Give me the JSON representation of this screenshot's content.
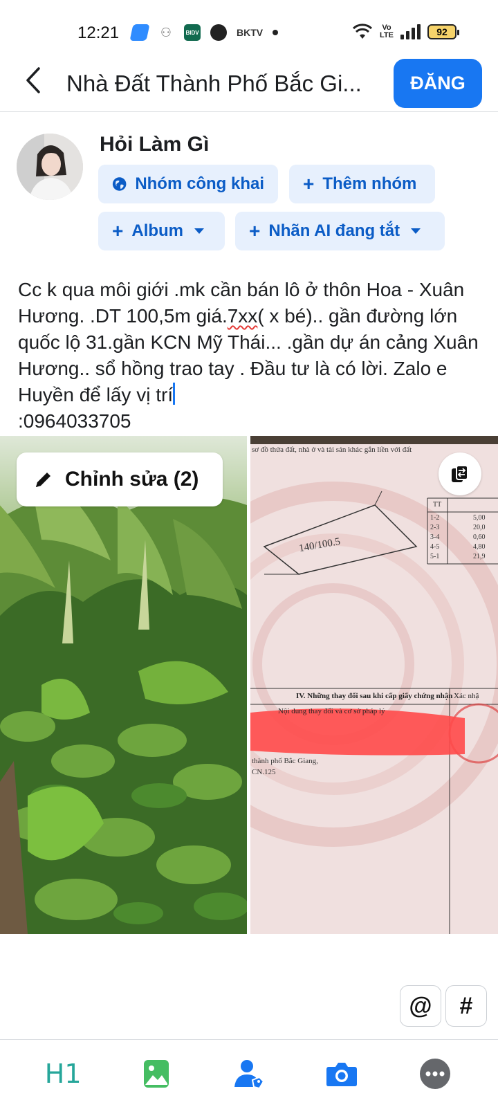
{
  "status_bar": {
    "time": "12:21",
    "bidv": "BIDV",
    "app_text": "BKTV",
    "volte": [
      "Vo",
      "LTE"
    ],
    "battery": "92"
  },
  "header": {
    "title": "Nhà Đất Thành Phố Bắc Gi...",
    "post_button": "ĐĂNG"
  },
  "composer": {
    "user_name": "Hỏi Làm Gì",
    "chips": {
      "public_group": "Nhóm công khai",
      "add_group": "Thêm nhóm",
      "album": "Album",
      "ai_label": "Nhãn AI đang tắt"
    }
  },
  "post": {
    "text_before": " Cc k qua môi giới .mk cần bán lô ở thôn Hoa - Xuân Hương. .DT 100,5m  giá.",
    "underlined": "7xx",
    "text_middle": "( x bé).. gần đường lớn quốc lộ 31.gần KCN Mỹ Thái... .gần dự án cảng Xuân Hương.. sổ hồng trao tay . Đầu tư là có lời. Zalo e Huyền để lấy vị trí",
    "text_after": ":0964033705"
  },
  "media": {
    "edit_button": "Chỉnh sửa (2)",
    "certificate": {
      "header": "sơ đồ thửa đất, nhà ở và tài sản khác gắn liền với đất",
      "lot_label": "140/100.5",
      "table_header": "TT",
      "table_rows": [
        "1-2",
        "2-3",
        "3-4",
        "4-5",
        "5-1"
      ],
      "table_values": [
        "5,00",
        "20,0",
        "0,60",
        "4,80",
        "21,9"
      ],
      "section_title": "IV. Những thay đổi sau khi cấp giấy chứng nhận",
      "column_left": "Nội dung thay đổi và cơ sở pháp lý",
      "column_right": "Xác nhậ",
      "partial_text_1": "thành phố Bắc Giang,",
      "partial_text_2": "CN.125"
    }
  },
  "quick_buttons": {
    "mention": "@",
    "hashtag": "#"
  },
  "toolbar": {
    "heading": "H1"
  },
  "colors": {
    "accent": "#1877f2",
    "chip_bg": "#e7f0fd",
    "chip_text": "#0b5cc6",
    "heading_tool": "#26a69a",
    "photo_tool": "#45bd62",
    "tag_tool": "#1877f2",
    "camera_tool": "#1877f2",
    "more_tool": "#65676b"
  },
  "icons": {
    "back": "chevron-left-icon",
    "globe": "globe-icon",
    "edit": "pencil-icon",
    "swap": "swap-icon",
    "photo": "photo-icon",
    "tag_person": "tag-person-icon",
    "camera": "camera-icon",
    "more": "more-icon"
  }
}
